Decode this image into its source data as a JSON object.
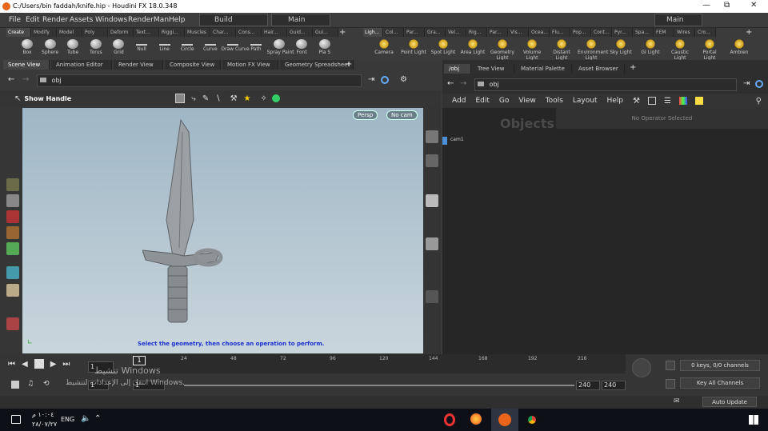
{
  "window": {
    "title": "C:/Users/bin faddah/knife.hip - Houdini FX 18.0.348"
  },
  "menu": {
    "items": [
      "File",
      "Edit",
      "Render",
      "Assets",
      "Windows",
      "RenderMan",
      "Help"
    ],
    "desktop": "Build",
    "layout": "Main",
    "right_layout": "Main"
  },
  "shelf_left": {
    "tabs": [
      "Create",
      "Modify",
      "Model",
      "Poly",
      "Deform",
      "Text...",
      "Riggi...",
      "Muscles",
      "Char...",
      "Cons...",
      "Hair...",
      "Guid...",
      "Gui..."
    ],
    "tools": [
      "Box",
      "Sphere",
      "Tube",
      "Torus",
      "Grid",
      "Null",
      "Line",
      "Circle",
      "Curve",
      "Draw Curve",
      "Path",
      "Spray Paint",
      "Font",
      "Pla S"
    ]
  },
  "shelf_right": {
    "tabs": [
      "Ligh...",
      "Col...",
      "Par...",
      "Gra...",
      "Vel...",
      "Rig...",
      "Par...",
      "Vis...",
      "Ocea...",
      "Flu...",
      "Pop...",
      "Cont...",
      "Pyr...",
      "Spa...",
      "FEM",
      "Wires",
      "Cro..."
    ],
    "tools": [
      "Camera",
      "Point Light",
      "Spot Light",
      "Area Light",
      "Geometry Light",
      "Volume Light",
      "Distant Light",
      "Environment Light",
      "Sky Light",
      "GI Light",
      "Caustic Light",
      "Portal Light",
      "Ambien"
    ]
  },
  "left_tabs": [
    "Scene View",
    "Animation Editor",
    "Render View",
    "Composite View",
    "Motion FX View",
    "Geometry Spreadsheet"
  ],
  "left_path": "obj",
  "viewport": {
    "handle_label": "Show Handle",
    "camera_persp": "Persp",
    "camera_cam": "No cam",
    "hint": "Select the geometry, then choose an operation to perform."
  },
  "right_tabs": [
    "/obj",
    "Tree View",
    "Material Palette",
    "Asset Browser"
  ],
  "right_path": "obj",
  "network": {
    "menu": [
      "Add",
      "Edit",
      "Go",
      "View",
      "Tools",
      "Layout",
      "Help"
    ],
    "watermark": "Objects",
    "status": "No Operator Selected",
    "node": "cam1"
  },
  "timeline": {
    "ticks": [
      "24",
      "48",
      "72",
      "96",
      "120",
      "144",
      "168",
      "192",
      "216"
    ],
    "current_frame": "1",
    "start": "1",
    "start2": "1",
    "end": "240",
    "end2": "240",
    "keys_info": "0 keys, 0/0 channels",
    "key_all": "Key All Channels",
    "auto_update": "Auto Update"
  },
  "activation": {
    "line1": "تنشيط Windows",
    "line2": "انتقل إلى الإعدادات لتنشيط Windows."
  },
  "taskbar": {
    "time": "١٠:٠٤ م",
    "date": "٢٨/٠٧/٢٧",
    "lang": "ENG"
  }
}
